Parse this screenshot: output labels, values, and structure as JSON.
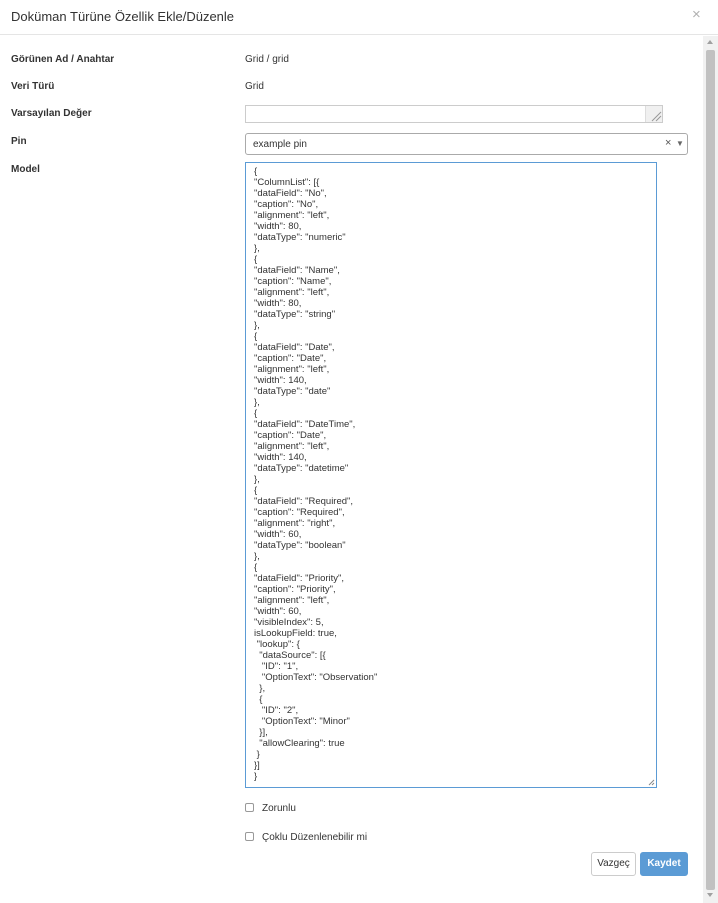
{
  "dialog": {
    "title": "Doküman Türüne Özellik Ekle/Düzenle",
    "close_symbol": "×"
  },
  "fields": {
    "display_name": {
      "label": "Görünen Ad / Anahtar",
      "value": "Grid / grid"
    },
    "data_type": {
      "label": "Veri Türü",
      "value": "Grid"
    },
    "default_value": {
      "label": "Varsayılan Değer",
      "value": ""
    },
    "pin": {
      "label": "Pin",
      "value": "example pin",
      "clear_symbol": "×",
      "caret_symbol": "▼"
    },
    "model": {
      "label": "Model",
      "value": "{\n\"ColumnList\": [{\n\"dataField\": \"No\",\n\"caption\": \"No\",\n\"alignment\": \"left\",\n\"width\": 80,\n\"dataType\": \"numeric\"\n},\n{\n\"dataField\": \"Name\",\n\"caption\": \"Name\",\n\"alignment\": \"left\",\n\"width\": 80,\n\"dataType\": \"string\"\n},\n{\n\"dataField\": \"Date\",\n\"caption\": \"Date\",\n\"alignment\": \"left\",\n\"width\": 140,\n\"dataType\": \"date\"\n},\n{\n\"dataField\": \"DateTime\",\n\"caption\": \"Date\",\n\"alignment\": \"left\",\n\"width\": 140,\n\"dataType\": \"datetime\"\n},\n{\n\"dataField\": \"Required\",\n\"caption\": \"Required\",\n\"alignment\": \"right\",\n\"width\": 60,\n\"dataType\": \"boolean\"\n},\n{\n\"dataField\": \"Priority\",\n\"caption\": \"Priority\",\n\"alignment\": \"left\",\n\"width\": 60,\n\"visibleIndex\": 5,\nisLookupField: true,\n \"lookup\": {\n  \"dataSource\": [{\n   \"ID\": \"1\",\n   \"OptionText\": \"Observation\"\n  },\n  {\n   \"ID\": \"2\",\n   \"OptionText\": \"Minor\"\n  }],\n  \"allowClearing\": true\n }\n}]\n}"
    }
  },
  "checkboxes": {
    "required": {
      "label": "Zorunlu",
      "checked": false
    },
    "multi_edit": {
      "label": "Çoklu Düzenlenebilir mi",
      "checked": false
    }
  },
  "buttons": {
    "cancel": "Vazgeç",
    "save": "Kaydet"
  },
  "colors": {
    "primary": "#5b9bd5",
    "border": "#cccccc"
  }
}
